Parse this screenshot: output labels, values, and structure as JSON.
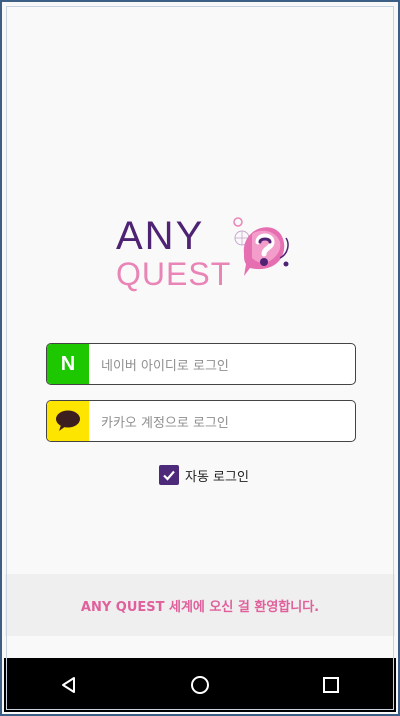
{
  "logo": {
    "line1": "ANY",
    "line2": "QUEST",
    "mark_icon": "speech-bubble-question-icon"
  },
  "login": {
    "naver": {
      "badge_text": "N",
      "label": "네이버 아이디로 로그인",
      "color": "#1ec800"
    },
    "kakao": {
      "badge_icon": "chat-bubble-icon",
      "label": "카카오 계정으로 로그인",
      "color": "#fee500"
    }
  },
  "auto_login": {
    "label": "자동 로그인",
    "checked": true,
    "color": "#4e2a7a"
  },
  "welcome": {
    "text": "ANY QUEST 세계에 오신 걸 환영합니다.",
    "color": "#e0609c"
  },
  "navbar": {
    "back_icon": "back-triangle-icon",
    "home_icon": "home-circle-icon",
    "recents_icon": "recents-square-icon"
  }
}
